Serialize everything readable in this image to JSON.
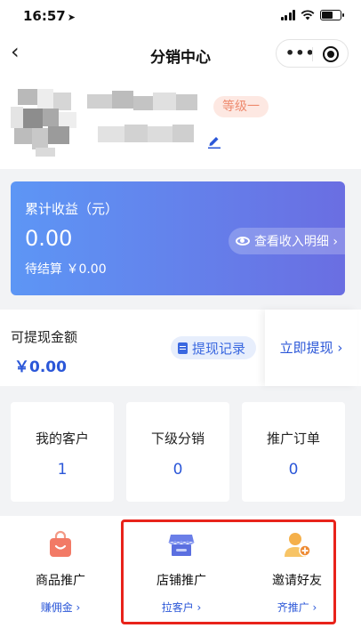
{
  "status_bar": {
    "time": "16:57",
    "location_glyph": "➤"
  },
  "nav": {
    "back_glyph": "‹",
    "title": "分销中心",
    "more_glyph": "•••"
  },
  "profile": {
    "level_badge": "等级一"
  },
  "income": {
    "label": "累计收益（元）",
    "amount": "0.00",
    "pending": "待结算 ￥0.00",
    "detail_button": "查看收入明细 ›"
  },
  "withdraw": {
    "label": "可提现金额",
    "amount": "￥0.00",
    "records_button": "提现记录",
    "withdraw_button": "立即提现 ›"
  },
  "stats": [
    {
      "label": "我的客户",
      "value": "1"
    },
    {
      "label": "下级分销",
      "value": "0"
    },
    {
      "label": "推广订单",
      "value": "0"
    }
  ],
  "promo": [
    {
      "name": "商品推广",
      "action": "赚佣金 ›",
      "icon": "shopping-bag-icon"
    },
    {
      "name": "店铺推广",
      "action": "拉客户 ›",
      "icon": "store-icon"
    },
    {
      "name": "邀请好友",
      "action": "齐推广 ›",
      "icon": "add-friend-icon"
    }
  ],
  "colors": {
    "accent": "#2b57d8",
    "card_gradient_start": "#5d96f5",
    "card_gradient_end": "#6a6ee2",
    "level_badge_bg": "#fde8e2",
    "level_badge_text": "#ee8a6e",
    "highlight_border": "#e8231b"
  }
}
